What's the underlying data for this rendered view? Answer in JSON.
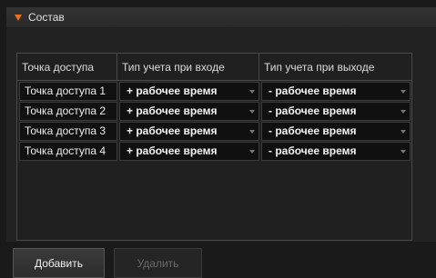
{
  "section": {
    "title": "Состав",
    "accent_color": "#e6731e",
    "expand_icon": "triangle-down-icon"
  },
  "table": {
    "columns": [
      "Точка доступа",
      "Тип учета при входе",
      "Тип учета при выходе"
    ],
    "rows": [
      {
        "name": "Точка доступа 1",
        "entry": "+ рабочее время",
        "exit": "- рабочее время"
      },
      {
        "name": "Точка доступа 2",
        "entry": "+ рабочее время",
        "exit": "- рабочее время"
      },
      {
        "name": "Точка доступа 3",
        "entry": "+ рабочее время",
        "exit": "- рабочее время"
      },
      {
        "name": "Точка доступа 4",
        "entry": "+ рабочее время",
        "exit": "- рабочее время"
      }
    ]
  },
  "buttons": {
    "add": "Добавить",
    "delete": "Удалить"
  }
}
